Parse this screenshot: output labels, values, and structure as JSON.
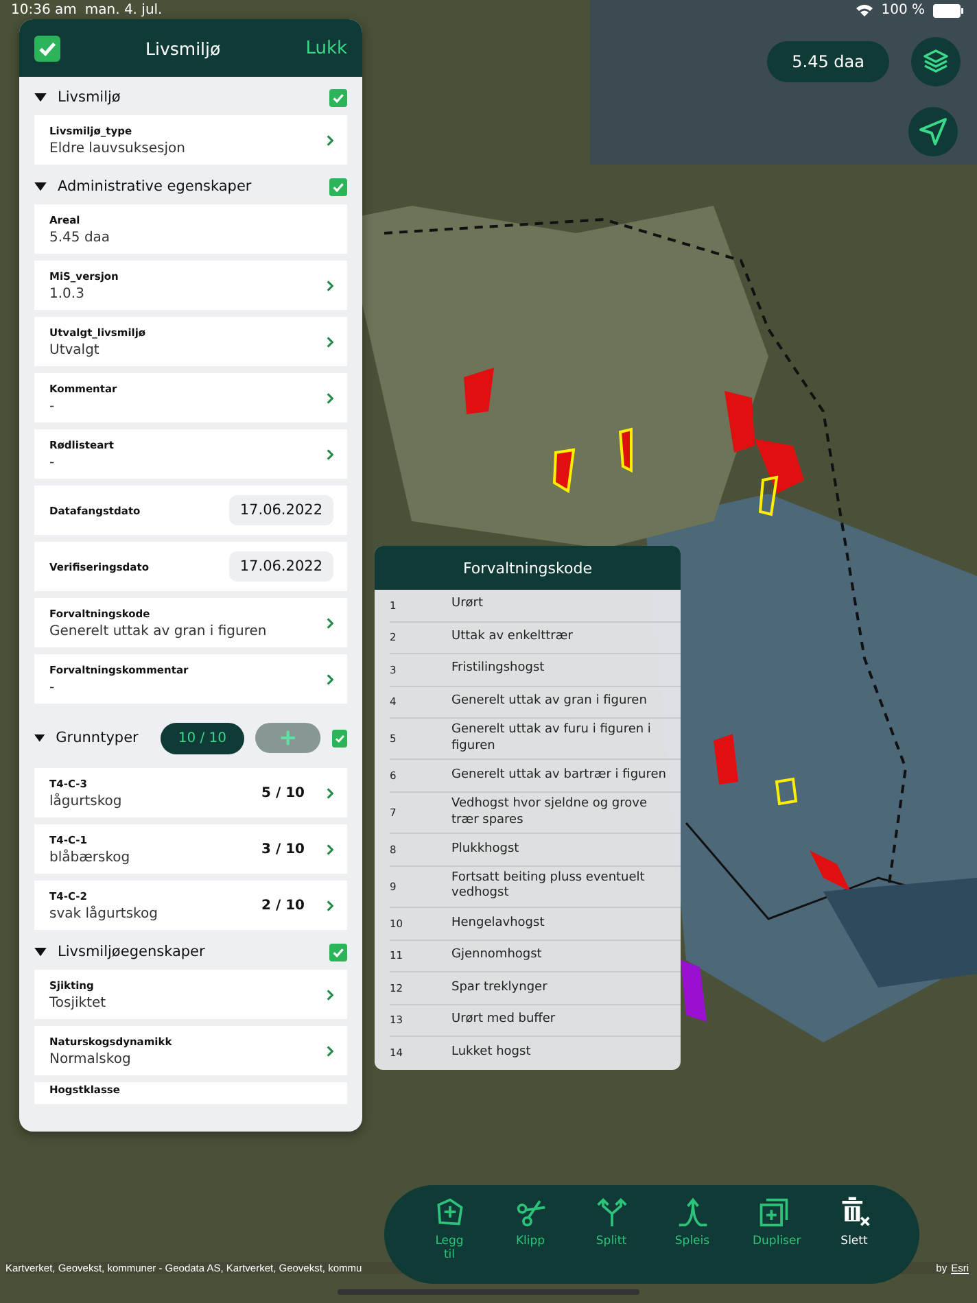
{
  "status_bar": {
    "time": "10:36 am",
    "date": "man. 4. jul.",
    "battery": "100 %"
  },
  "panel": {
    "title": "Livsmiljø",
    "checked": true,
    "close_label": "Lukk",
    "sections": [
      {
        "title": "Livsmiljø",
        "expanded": true,
        "checked": true,
        "fields": [
          {
            "kind": "select",
            "label": "Livsmiljø_type",
            "value": "Eldre lauvsuksesjon"
          }
        ]
      },
      {
        "title": "Administrative egenskaper",
        "expanded": true,
        "checked": true,
        "fields": [
          {
            "kind": "text",
            "label": "Areal",
            "value": "5.45 daa"
          },
          {
            "kind": "select",
            "label": "MiS_versjon",
            "value": "1.0.3"
          },
          {
            "kind": "select",
            "label": "Utvalgt_livsmiljø",
            "value": "Utvalgt"
          },
          {
            "kind": "select",
            "label": "Kommentar",
            "value": "-"
          },
          {
            "kind": "select",
            "label": "Rødlisteart",
            "value": "-"
          },
          {
            "kind": "date",
            "label": "Datafangstdato",
            "value": "17.06.2022"
          },
          {
            "kind": "date",
            "label": "Verifiseringsdato",
            "value": "17.06.2022"
          },
          {
            "kind": "select",
            "label": "Forvaltningskode",
            "value": "Generelt uttak av gran i figuren"
          },
          {
            "kind": "select",
            "label": "Forvaltningskommentar",
            "value": "-"
          }
        ]
      },
      {
        "title": "Grunntyper",
        "expanded": true,
        "checked": true,
        "counter": "10 / 10",
        "fields": [
          {
            "kind": "count",
            "label": "T4-C-3",
            "value": "lågurtskog",
            "count": "5 / 10"
          },
          {
            "kind": "count",
            "label": "T4-C-1",
            "value": "blåbærskog",
            "count": "3 / 10"
          },
          {
            "kind": "count",
            "label": "T4-C-2",
            "value": "svak lågurtskog",
            "count": "2 / 10"
          }
        ]
      },
      {
        "title": "Livsmiljøegenskaper",
        "expanded": true,
        "checked": true,
        "fields": [
          {
            "kind": "select",
            "label": "Sjikting",
            "value": "Tosjiktet"
          },
          {
            "kind": "select",
            "label": "Naturskogsdynamikk",
            "value": "Normalskog"
          },
          {
            "kind": "partial",
            "label": "Hogstklasse"
          }
        ]
      }
    ]
  },
  "area_badge": "5.45 daa",
  "picker": {
    "title": "Forvaltningskode",
    "options": [
      {
        "number": "1",
        "label": "Urørt"
      },
      {
        "number": "2",
        "label": "Uttak av enkelttrær"
      },
      {
        "number": "3",
        "label": "Fristilingshogst"
      },
      {
        "number": "4",
        "label": "Generelt uttak av gran i figuren"
      },
      {
        "number": "5",
        "label": "Generelt uttak av furu i figuren i figuren"
      },
      {
        "number": "6",
        "label": "Generelt uttak av bartrær i figuren"
      },
      {
        "number": "7",
        "label": "Vedhogst hvor sjeldne og grove trær spares"
      },
      {
        "number": "8",
        "label": "Plukkhogst"
      },
      {
        "number": "9",
        "label": "Fortsatt beiting pluss eventuelt vedhogst"
      },
      {
        "number": "10",
        "label": "Hengelavhogst"
      },
      {
        "number": "11",
        "label": "Gjennomhogst"
      },
      {
        "number": "12",
        "label": "Spar treklynger"
      },
      {
        "number": "13",
        "label": "Urørt med buffer"
      },
      {
        "number": "14",
        "label": "Lukket hogst"
      }
    ]
  },
  "toolbar": [
    {
      "kind": "add",
      "label": "Legg til"
    },
    {
      "kind": "clip",
      "label": "Klipp"
    },
    {
      "kind": "split",
      "label": "Splitt"
    },
    {
      "kind": "join",
      "label": "Spleis"
    },
    {
      "kind": "duplicate",
      "label": "Dupliser"
    },
    {
      "kind": "delete",
      "label": "Slett"
    }
  ],
  "attribution": {
    "text": "Kartverket, Geovekst, kommuner - Geodata AS, Kartverket, Geovekst, kommu",
    "credit": "by",
    "link": "Esri"
  }
}
